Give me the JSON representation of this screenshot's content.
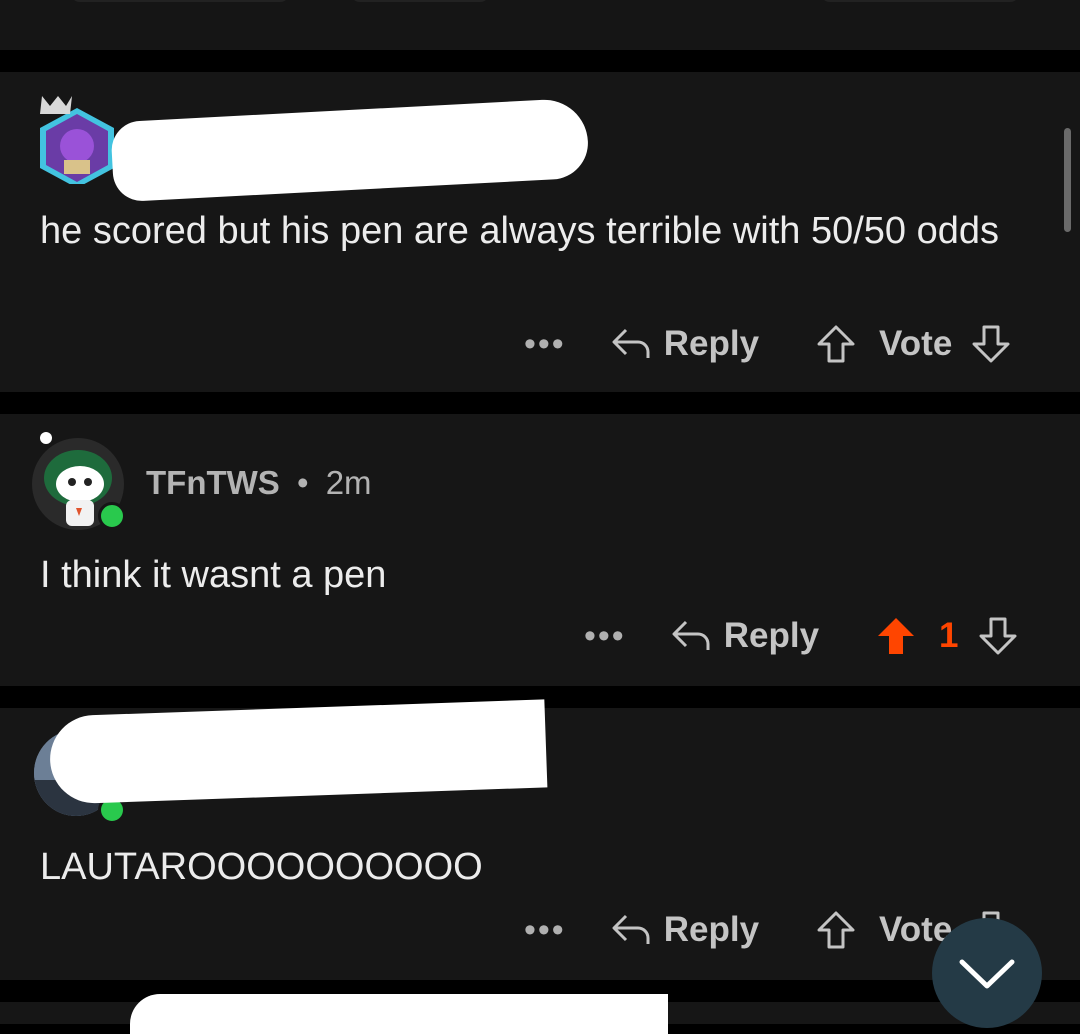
{
  "comments": [
    {
      "username": "",
      "text": "he scored but his pen are always terrible with 50/50 odds",
      "actions": {
        "more": "•••",
        "reply": "Reply",
        "vote": "Vote"
      }
    },
    {
      "username": "TFnTWS",
      "separator": "•",
      "timestamp": "2m",
      "text": "I think it wasnt a pen",
      "actions": {
        "more": "•••",
        "reply": "Reply",
        "vote_count": "1",
        "upvoted": true
      }
    },
    {
      "username": "",
      "text": "LAUTAROOOOOOOOOO",
      "actions": {
        "more": "•••",
        "reply": "Reply",
        "vote": "Vote"
      }
    }
  ],
  "colors": {
    "background": "#000000",
    "card": "#161616",
    "text": "#ececec",
    "muted": "#b3b3b3",
    "upvote_active": "#ff4500",
    "online": "#29c94d",
    "fab": "#243a46"
  },
  "icons": {
    "reply": "reply-arrow-icon",
    "upvote": "arrow-up-icon",
    "downvote": "arrow-down-icon",
    "scroll_down": "chevron-down-icon"
  }
}
